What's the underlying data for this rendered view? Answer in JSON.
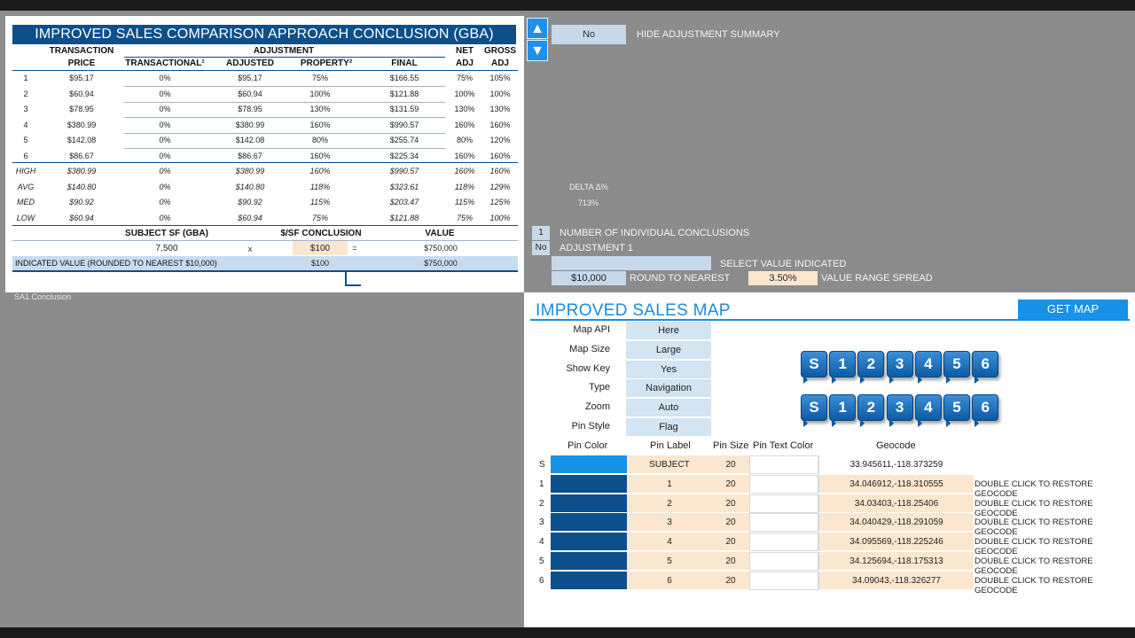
{
  "conclusion": {
    "title": "IMPROVED SALES COMPARISON APPROACH CONCLUSION (GBA)",
    "headers": {
      "transaction": "TRANSACTION",
      "price": "PRICE",
      "adjustment": "ADJUSTMENT",
      "transactional": "TRANSACTIONAL¹",
      "adjusted": "ADJUSTED",
      "property": "PROPERTY²",
      "final": "FINAL",
      "net": "NET",
      "adj": "ADJ",
      "gross": "GROSS",
      "adj2": "ADJ"
    },
    "rows": [
      {
        "label": "1",
        "price": "$95.17",
        "trans": "0%",
        "adjusted": "$95.17",
        "property": "75%",
        "final": "$166.55",
        "net": "75%",
        "gross": "105%"
      },
      {
        "label": "2",
        "price": "$60.94",
        "trans": "0%",
        "adjusted": "$60.94",
        "property": "100%",
        "final": "$121.88",
        "net": "100%",
        "gross": "100%"
      },
      {
        "label": "3",
        "price": "$78.95",
        "trans": "0%",
        "adjusted": "$78.95",
        "property": "130%",
        "final": "$131.59",
        "net": "130%",
        "gross": "130%"
      },
      {
        "label": "4",
        "price": "$380.99",
        "trans": "0%",
        "adjusted": "$380.99",
        "property": "160%",
        "final": "$990.57",
        "net": "160%",
        "gross": "160%"
      },
      {
        "label": "5",
        "price": "$142.08",
        "trans": "0%",
        "adjusted": "$142.08",
        "property": "80%",
        "final": "$255.74",
        "net": "80%",
        "gross": "120%"
      },
      {
        "label": "6",
        "price": "$86.67",
        "trans": "0%",
        "adjusted": "$86.67",
        "property": "160%",
        "final": "$225.34",
        "net": "160%",
        "gross": "160%"
      }
    ],
    "stats": [
      {
        "label": "HIGH",
        "price": "$380.99",
        "trans": "0%",
        "adjusted": "$380.99",
        "property": "160%",
        "final": "$990.57",
        "net": "160%",
        "gross": "160%"
      },
      {
        "label": "AVG",
        "price": "$140.80",
        "trans": "0%",
        "adjusted": "$140.80",
        "property": "118%",
        "final": "$323.61",
        "net": "118%",
        "gross": "129%"
      },
      {
        "label": "MED",
        "price": "$90.92",
        "trans": "0%",
        "adjusted": "$90.92",
        "property": "115%",
        "final": "$203.47",
        "net": "115%",
        "gross": "125%"
      },
      {
        "label": "LOW",
        "price": "$60.94",
        "trans": "0%",
        "adjusted": "$60.94",
        "property": "75%",
        "final": "$121.88",
        "net": "75%",
        "gross": "100%"
      }
    ],
    "subject_sf_label": "SUBJECT SF (GBA)",
    "psf_label": "$/SF CONCLUSION",
    "value_label": "VALUE",
    "subject_sf": "7,500",
    "times": "x",
    "psf": "$100",
    "equals": "=",
    "value": "$750,000",
    "indicated_label": "INDICATED VALUE (ROUNDED TO NEAREST $10,000)",
    "indicated_psf": "$100",
    "indicated_value": "$750,000"
  },
  "sheet_label": "SA1 Conclusion",
  "summary": {
    "up_arrow": "▲",
    "down_arrow": "▼",
    "hide_value": "No",
    "hide_label": "HIDE ADJUSTMENT SUMMARY",
    "delta_label": "DELTA Δ%",
    "delta_value": "713%",
    "num_conclusions": "1",
    "num_conclusions_label": "NUMBER OF INDIVIDUAL CONCLUSIONS",
    "adj_no": "No",
    "adj_label": "ADJUSTMENT 1",
    "select_label": "SELECT VALUE INDICATED",
    "round_value": "$10,000",
    "round_label": "ROUND TO NEAREST",
    "spread_value": "3.50%",
    "spread_label": "VALUE RANGE SPREAD"
  },
  "map": {
    "title": "IMPROVED SALES MAP",
    "get_map": "GET MAP",
    "options": [
      {
        "label": "Map API",
        "value": "Here"
      },
      {
        "label": "Map Size",
        "value": "Large"
      },
      {
        "label": "Show Key",
        "value": "Yes"
      },
      {
        "label": "Type",
        "value": "Navigation"
      },
      {
        "label": "Zoom",
        "value": "Auto"
      },
      {
        "label": "Pin Style",
        "value": "Flag"
      }
    ],
    "pins_row1": [
      "S",
      "1",
      "2",
      "3",
      "4",
      "5",
      "6"
    ],
    "pins_row2": [
      "S",
      "1",
      "2",
      "3",
      "4",
      "5",
      "6"
    ],
    "columns": {
      "pin_color": "Pin Color",
      "pin_label": "Pin Label",
      "pin_size": "Pin Size",
      "pin_text_color": "Pin Text Color",
      "geocode": "Geocode"
    },
    "rows": [
      {
        "idx": "S",
        "label": "SUBJECT",
        "size": "20",
        "geocode": "33.945611,-118.373259",
        "restore": ""
      },
      {
        "idx": "1",
        "label": "1",
        "size": "20",
        "geocode": "34.046912,-118.310555",
        "restore": "DOUBLE CLICK TO RESTORE GEOCODE"
      },
      {
        "idx": "2",
        "label": "2",
        "size": "20",
        "geocode": "34.03403,-118.25406",
        "restore": "DOUBLE CLICK TO RESTORE GEOCODE"
      },
      {
        "idx": "3",
        "label": "3",
        "size": "20",
        "geocode": "34.040429,-118.291059",
        "restore": "DOUBLE CLICK TO RESTORE GEOCODE"
      },
      {
        "idx": "4",
        "label": "4",
        "size": "20",
        "geocode": "34.095569,-118.225246",
        "restore": "DOUBLE CLICK TO RESTORE GEOCODE"
      },
      {
        "idx": "5",
        "label": "5",
        "size": "20",
        "geocode": "34.125694,-118.175313",
        "restore": "DOUBLE CLICK TO RESTORE GEOCODE"
      },
      {
        "idx": "6",
        "label": "6",
        "size": "20",
        "geocode": "34.09043,-118.326277",
        "restore": "DOUBLE CLICK TO RESTORE GEOCODE"
      }
    ]
  },
  "colors": {
    "accent": "#1792e6",
    "dark_blue": "#0d4f8b",
    "peach": "#fbe6cf",
    "light_blue": "#c9dcef"
  }
}
